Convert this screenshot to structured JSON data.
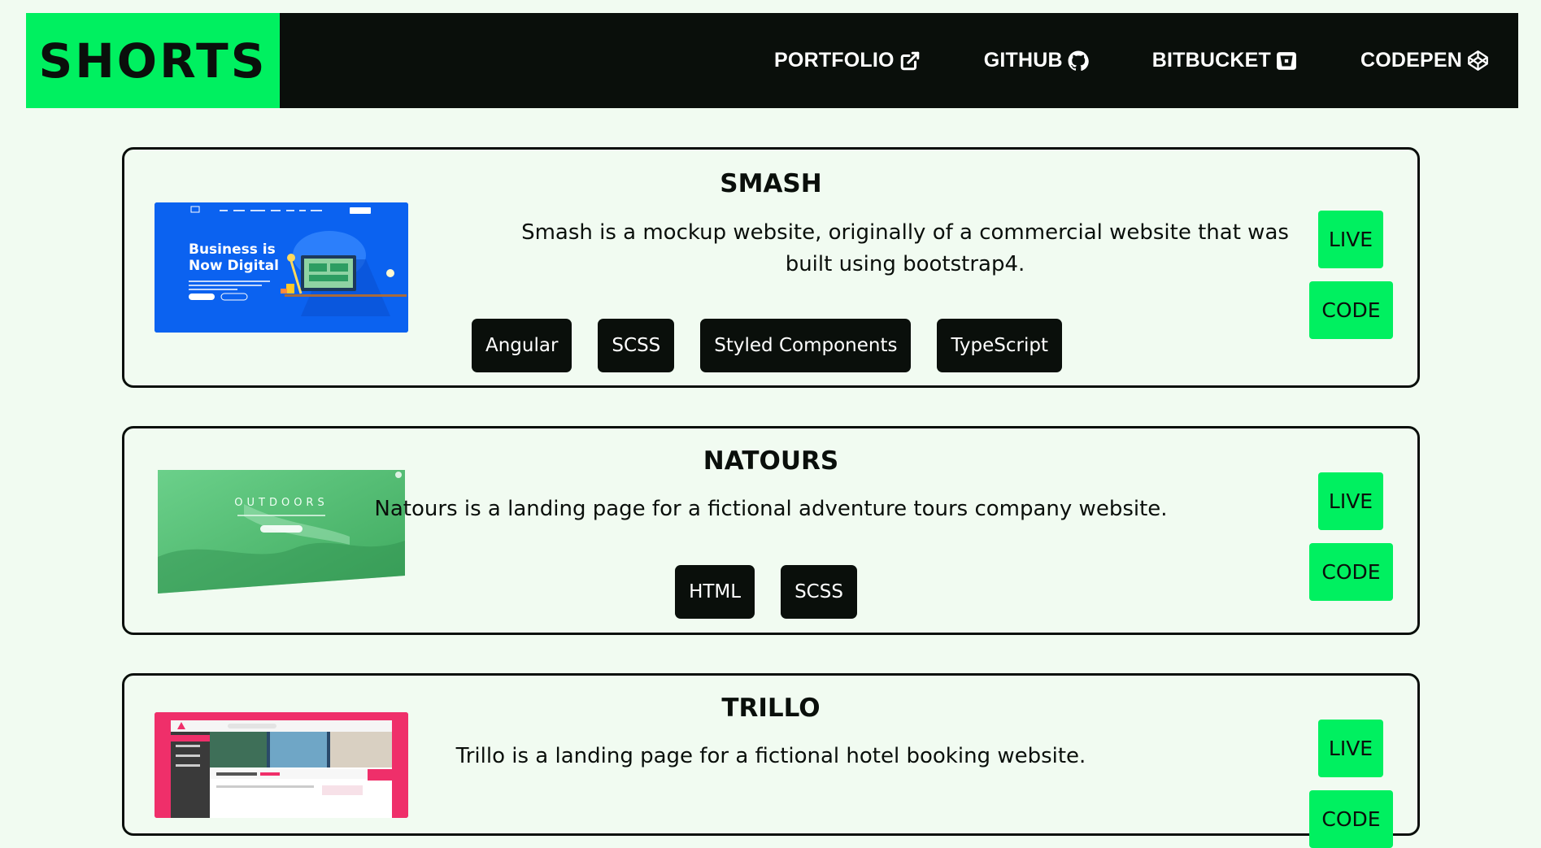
{
  "brand": {
    "logo_text": "SHORTS",
    "accent": "#00f060",
    "dark": "#0a0f0b",
    "background": "#f1fbf1"
  },
  "nav": {
    "items": [
      {
        "label": "PORTFOLIO",
        "icon": "external-link-icon"
      },
      {
        "label": "GITHUB",
        "icon": "github-icon"
      },
      {
        "label": "BITBUCKET",
        "icon": "bitbucket-icon"
      },
      {
        "label": "CODEPEN",
        "icon": "codepen-icon"
      }
    ]
  },
  "projects": [
    {
      "title": "SMASH",
      "description": "Smash is a mockup website, originally of a commercial website that was built using bootstrap4.",
      "tags": [
        "Angular",
        "SCSS",
        "Styled Components",
        "TypeScript"
      ],
      "live_label": "LIVE",
      "code_label": "CODE",
      "thumbnail": {
        "headline_1": "Business is",
        "headline_2": "Now Digital"
      }
    },
    {
      "title": "NATOURS",
      "description": "Natours is a landing page for a fictional adventure tours company website.",
      "tags": [
        "HTML",
        "SCSS"
      ],
      "live_label": "LIVE",
      "code_label": "CODE",
      "thumbnail": {
        "headline_1": "OUTDOORS"
      }
    },
    {
      "title": "TRILLO",
      "description": "Trillo is a landing page for a fictional hotel booking website.",
      "tags": [],
      "live_label": "LIVE",
      "code_label": "CODE",
      "thumbnail": {}
    }
  ]
}
